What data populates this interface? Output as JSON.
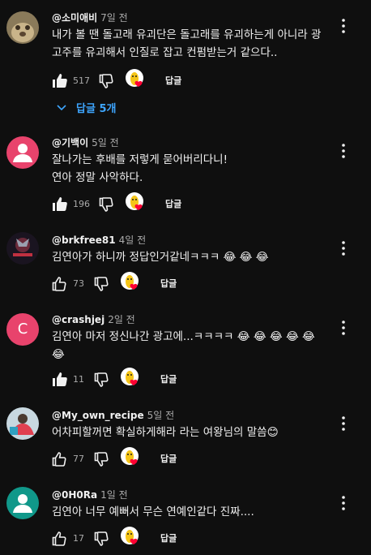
{
  "colors": {
    "background": "#0f0f0f",
    "text": "#f1f1f1",
    "secondary": "#aaaaaa",
    "link": "#3ea6ff",
    "heart": "#ff0033"
  },
  "comments": [
    {
      "author": "@소미애비",
      "time": "7일 전",
      "lines": [
        "내가 볼 땐 돌고래 유괴단은 돌고래를 유괴하는게 아니라 광",
        "고주를 유괴해서 인질로 잡고 컨펌받는거 같으다.."
      ],
      "likes": "517",
      "liked": true,
      "reply_label": "답글",
      "replies_label": "답글 5개",
      "avatar_icon": "photo-avatar"
    },
    {
      "author": "@기백이",
      "time": "5일 전",
      "lines": [
        "잘나가는 후배를 저렇게 묻어버리다니!",
        "연아 정말 사악하다."
      ],
      "likes": "196",
      "liked": true,
      "reply_label": "답글",
      "avatar_icon": "default-person-avatar",
      "avatar_color": "#e8436c"
    },
    {
      "author": "@brkfree81",
      "time": "4일 전",
      "lines": [
        "김연아가 하니까 정답인거같네ㅋㅋㅋ 😂 😂 😂"
      ],
      "likes": "73",
      "liked": false,
      "reply_label": "답글",
      "avatar_icon": "logo-avatar"
    },
    {
      "author": "@crashjej",
      "time": "2일 전",
      "lines": [
        "김연아 마저 정신나간 광고에...ㅋㅋㅋㅋ 😂 😂 😂 😂 😂",
        "😂"
      ],
      "likes": "11",
      "liked": true,
      "reply_label": "답글",
      "avatar_icon": "letter-avatar",
      "avatar_letter": "C",
      "avatar_color": "#e8436c"
    },
    {
      "author": "@My_own_recipe",
      "time": "5일 전",
      "lines": [
        "어차피할꺼면 확실하게해라 라는 여왕님의 말씀😊"
      ],
      "likes": "77",
      "liked": false,
      "reply_label": "답글",
      "avatar_icon": "photo-avatar"
    },
    {
      "author": "@0H0Ra",
      "time": "1일 전",
      "lines": [
        "김연아 너무 예뻐서 무슨 연예인같다 진짜...."
      ],
      "likes": "17",
      "liked": false,
      "reply_label": "답글",
      "avatar_icon": "default-person-avatar",
      "avatar_color": "#10988a"
    }
  ]
}
